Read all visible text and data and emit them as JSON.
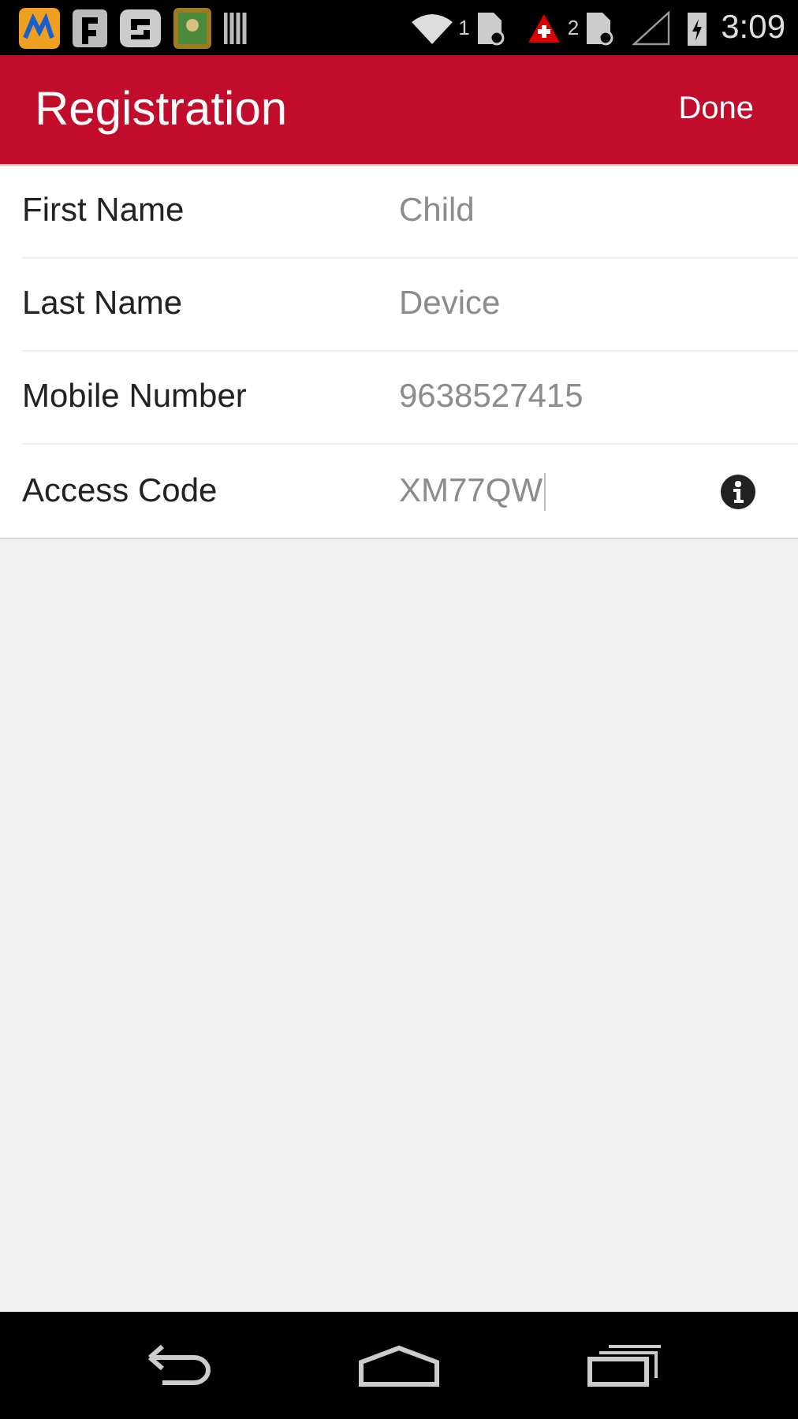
{
  "status_bar": {
    "sim_1": "1",
    "sim_2": "2",
    "time": "3:09"
  },
  "header": {
    "title": "Registration",
    "action": "Done"
  },
  "fields": [
    {
      "label": "First Name",
      "value": "Child",
      "has_info": false,
      "focused": false
    },
    {
      "label": "Last Name",
      "value": "Device",
      "has_info": false,
      "focused": false
    },
    {
      "label": "Mobile Number",
      "value": "9638527415",
      "has_info": false,
      "focused": false
    },
    {
      "label": "Access Code",
      "value": "XM77QW",
      "has_info": true,
      "focused": true
    }
  ]
}
